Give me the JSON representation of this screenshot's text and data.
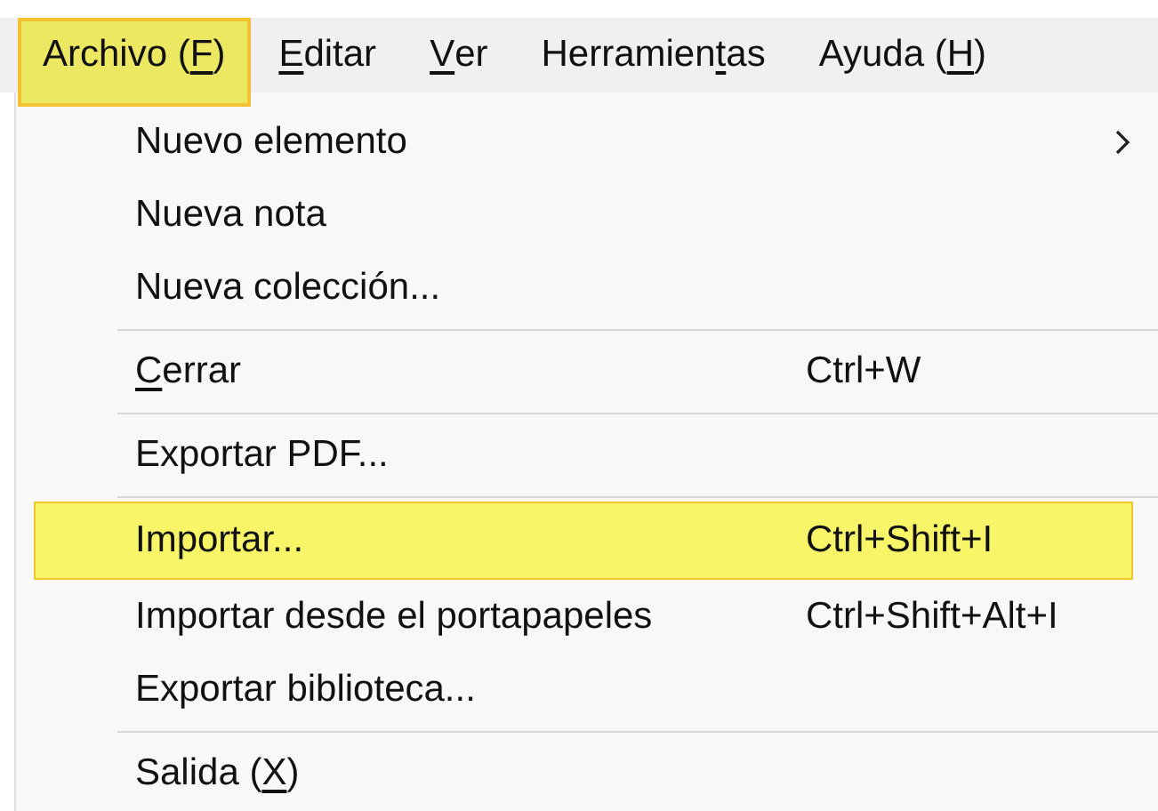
{
  "menubar": [
    {
      "label": [
        {
          "text": "Archivo (",
          "underlined": false
        },
        {
          "text": "F",
          "underlined": true
        },
        {
          "text": ")",
          "underlined": false
        }
      ],
      "selected": true
    },
    {
      "label": [
        {
          "text": "E",
          "underlined": true
        },
        {
          "text": "ditar",
          "underlined": false
        }
      ],
      "selected": false
    },
    {
      "label": [
        {
          "text": "V",
          "underlined": true
        },
        {
          "text": "er",
          "underlined": false
        }
      ],
      "selected": false
    },
    {
      "label": [
        {
          "text": "Herramien",
          "underlined": false
        },
        {
          "text": "t",
          "underlined": true
        },
        {
          "text": "as",
          "underlined": false
        }
      ],
      "selected": false
    },
    {
      "label": [
        {
          "text": "Ayuda (",
          "underlined": false
        },
        {
          "text": "H",
          "underlined": true
        },
        {
          "text": ")",
          "underlined": false
        }
      ],
      "selected": false
    }
  ],
  "menu": [
    {
      "kind": "item",
      "label": [
        {
          "text": "Nuevo elemento",
          "underlined": false
        }
      ],
      "submenu": true,
      "selected": false
    },
    {
      "kind": "item",
      "label": [
        {
          "text": "Nueva nota",
          "underlined": false
        }
      ],
      "selected": false
    },
    {
      "kind": "item",
      "label": [
        {
          "text": "Nueva colección...",
          "underlined": false
        }
      ],
      "selected": false
    },
    {
      "kind": "separator"
    },
    {
      "kind": "item",
      "label": [
        {
          "text": "C",
          "underlined": true
        },
        {
          "text": "errar",
          "underlined": false
        }
      ],
      "shortcut": "Ctrl+W",
      "selected": false
    },
    {
      "kind": "separator"
    },
    {
      "kind": "item",
      "label": [
        {
          "text": "Exportar PDF...",
          "underlined": false
        }
      ],
      "selected": false
    },
    {
      "kind": "separator"
    },
    {
      "kind": "item",
      "label": [
        {
          "text": "Importar...",
          "underlined": false
        }
      ],
      "shortcut": "Ctrl+Shift+I",
      "selected": true
    },
    {
      "kind": "item",
      "label": [
        {
          "text": "Importar desde el portapapeles",
          "underlined": false
        }
      ],
      "shortcut": "Ctrl+Shift+Alt+I",
      "selected": false
    },
    {
      "kind": "item",
      "label": [
        {
          "text": "Exportar biblioteca...",
          "underlined": false
        }
      ],
      "selected": false
    },
    {
      "kind": "separator"
    },
    {
      "kind": "item",
      "label": [
        {
          "text": "Salida (",
          "underlined": false
        },
        {
          "text": "X",
          "underlined": true
        },
        {
          "text": ")",
          "underlined": false
        }
      ],
      "selected": false
    }
  ]
}
